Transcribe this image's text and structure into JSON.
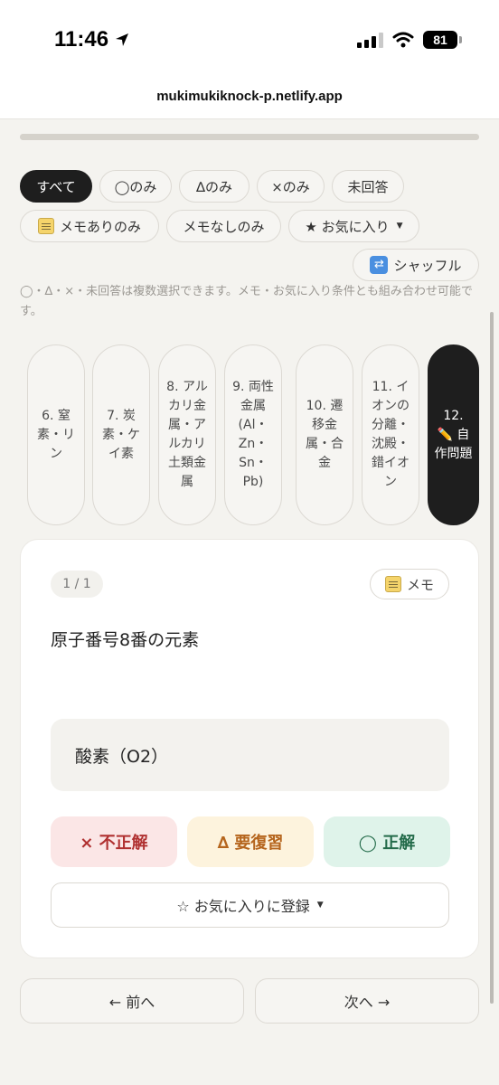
{
  "status": {
    "time": "11:46",
    "battery": "81"
  },
  "browser": {
    "url": "mukimukiknock-p.netlify.app"
  },
  "progress": {
    "fraction": 1.0
  },
  "filters": {
    "all": "すべて",
    "circle_only": "◯のみ",
    "triangle_only": "∆のみ",
    "cross_only": "×のみ",
    "unanswered": "未回答",
    "memo_only": "メモありのみ",
    "no_memo_only": "メモなしのみ",
    "favorites": "★ お気に入り",
    "shuffle": "シャッフル"
  },
  "hint": "◯・∆・×・未回答は複数選択できます。メモ・お気に入り条件とも組み合わせ可能です。",
  "categories": [
    {
      "label": "6. 窒素・リン"
    },
    {
      "label": "7. 炭素・ケイ素"
    },
    {
      "label": "8. アルカリ金属・アルカリ土類金属"
    },
    {
      "label": "9. 両性金属 (Al・Zn・Sn・Pb)"
    },
    {
      "label": "10. 遷移金属・合金"
    },
    {
      "label": "11. イオンの分離・沈殿・錯イオン"
    },
    {
      "label": "12. ✏️ 自作問題"
    }
  ],
  "card": {
    "counter": "1 / 1",
    "memo_button": "メモ",
    "question": "原子番号8番の元素",
    "answer": "酸素（O2）",
    "wrong_label": "× 不正解",
    "review_label": "∆ 要復習",
    "correct_label": "◯ 正解",
    "favorite_button": "☆ お気に入りに登録"
  },
  "nav": {
    "prev": "← 前へ",
    "next": "次へ →"
  }
}
